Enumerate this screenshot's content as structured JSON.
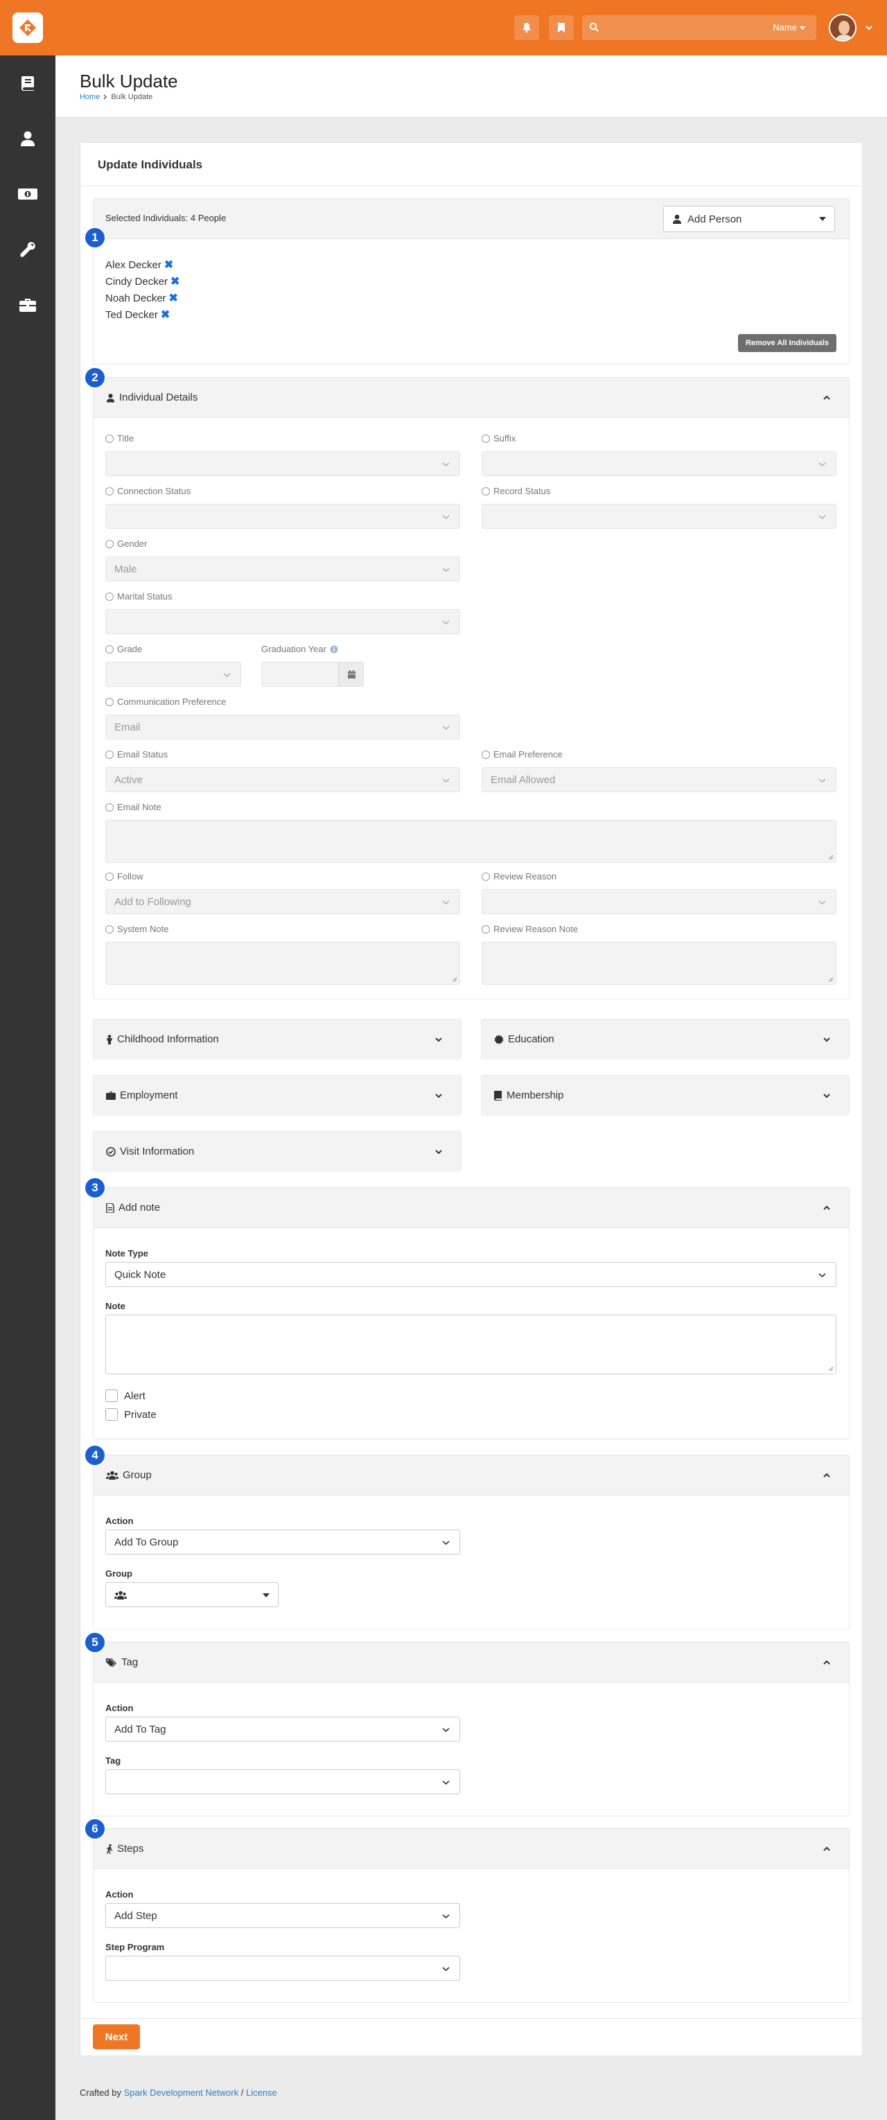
{
  "topbar": {
    "search_filter_label": "Name"
  },
  "colors": {
    "brand": "#ee7624",
    "badge": "#1c5ecf",
    "link": "#2b80c5",
    "sidebar": "#343434"
  },
  "sidebar": {
    "items": [
      {
        "icon": "book-icon"
      },
      {
        "icon": "user-icon"
      },
      {
        "icon": "money-icon"
      },
      {
        "icon": "wrench-icon"
      },
      {
        "icon": "briefcase-icon"
      }
    ]
  },
  "page": {
    "title": "Bulk Update",
    "breadcrumb": [
      "Home",
      "Bulk Update"
    ]
  },
  "panel": {
    "title": "Update Individuals"
  },
  "individuals": {
    "step": "1",
    "selected_label": "Selected Individuals: 4 People",
    "add_person_label": "Add Person",
    "people": [
      "Alex Decker",
      "Cindy Decker",
      "Noah Decker",
      "Ted Decker"
    ],
    "remove_all_label": "Remove All Individuals"
  },
  "details": {
    "step": "2",
    "title": "Individual Details",
    "fields": {
      "title": {
        "label": "Title",
        "value": ""
      },
      "suffix": {
        "label": "Suffix",
        "value": ""
      },
      "connection_status": {
        "label": "Connection Status",
        "value": ""
      },
      "record_status": {
        "label": "Record Status",
        "value": ""
      },
      "gender": {
        "label": "Gender",
        "value": "Male"
      },
      "marital_status": {
        "label": "Marital Status",
        "value": ""
      },
      "grade": {
        "label": "Grade",
        "value": ""
      },
      "graduation_year": {
        "label": "Graduation Year",
        "value": ""
      },
      "communication_preference": {
        "label": "Communication Preference",
        "value": "Email"
      },
      "email_status": {
        "label": "Email Status",
        "value": "Active"
      },
      "email_preference": {
        "label": "Email Preference",
        "value": "Email Allowed"
      },
      "email_note": {
        "label": "Email Note"
      },
      "follow": {
        "label": "Follow",
        "value": "Add to Following"
      },
      "review_reason": {
        "label": "Review Reason",
        "value": ""
      },
      "system_note": {
        "label": "System Note"
      },
      "review_reason_note": {
        "label": "Review Reason Note"
      }
    }
  },
  "collapsed_sections": {
    "childhood": "Childhood Information",
    "education": "Education",
    "employment": "Employment",
    "membership": "Membership",
    "visit": "Visit Information"
  },
  "note": {
    "step": "3",
    "title": "Add note",
    "note_type_label": "Note Type",
    "note_type_value": "Quick Note",
    "note_label": "Note",
    "alert_label": "Alert",
    "private_label": "Private"
  },
  "group": {
    "step": "4",
    "title": "Group",
    "action_label": "Action",
    "action_value": "Add To Group",
    "group_label": "Group"
  },
  "tag": {
    "step": "5",
    "title": "Tag",
    "action_label": "Action",
    "action_value": "Add To Tag",
    "tag_label": "Tag",
    "tag_value": ""
  },
  "steps": {
    "step": "6",
    "title": "Steps",
    "action_label": "Action",
    "action_value": "Add Step",
    "program_label": "Step Program",
    "program_value": ""
  },
  "actions": {
    "next_label": "Next"
  },
  "footer": {
    "prefix": "Crafted by",
    "network_link": "Spark Development Network",
    "separator": "/",
    "license_link": "License"
  }
}
